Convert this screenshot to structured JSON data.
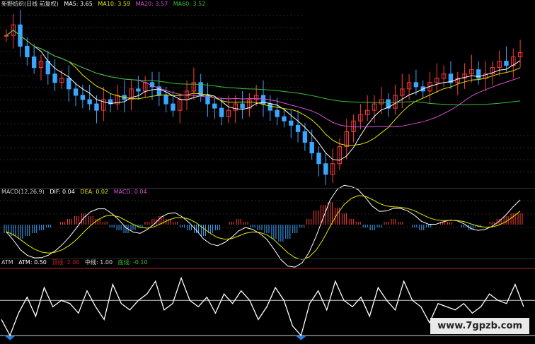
{
  "header_kline": {
    "title": "新野纺织(日线 前复权)",
    "ma5": "MA5: 3.65",
    "ma10": "MA10: 3.59",
    "ma20": "MA20: 3.57",
    "ma60": "MA60: 3.52"
  },
  "header_macd": {
    "title": "MACD(12,26,9)",
    "dif": "DIF: 0.04",
    "dea": "DEA: 0.02",
    "macd": "MACD: 0.04"
  },
  "header_atm": {
    "title": "ATM",
    "atm": "ATM: 0.50",
    "top": "顶线: 2.00",
    "mid": "中线: 1.00",
    "bottom": "底线: -0.10"
  },
  "watermark": "www.7gpzb.com",
  "colors": {
    "up": "#ff3b3b",
    "down": "#3aa6ff",
    "ma5": "#ffffff",
    "ma10": "#e6e600",
    "ma20": "#d94fd9",
    "ma60": "#36c236",
    "atm": "#ffffff",
    "atm_fill": "#2e7bd6",
    "top_line": "#cc2222"
  },
  "chart_data": [
    {
      "type": "candlestick",
      "name": "kline",
      "close": [
        3.7,
        3.75,
        3.65,
        3.6,
        3.55,
        3.58,
        3.52,
        3.48,
        3.5,
        3.45,
        3.42,
        3.4,
        3.38,
        3.35,
        3.4,
        3.38,
        3.42,
        3.4,
        3.45,
        3.44,
        3.48,
        3.46,
        3.42,
        3.38,
        3.35,
        3.4,
        3.44,
        3.48,
        3.42,
        3.38,
        3.36,
        3.32,
        3.35,
        3.38,
        3.36,
        3.4,
        3.42,
        3.38,
        3.35,
        3.32,
        3.3,
        3.28,
        3.25,
        3.2,
        3.15,
        3.1,
        3.05,
        3.1,
        3.18,
        3.25,
        3.3,
        3.33,
        3.35,
        3.38,
        3.4,
        3.36,
        3.42,
        3.45,
        3.48,
        3.46,
        3.44,
        3.48,
        3.5,
        3.52,
        3.48,
        3.5,
        3.52,
        3.54,
        3.5,
        3.52,
        3.55,
        3.58,
        3.56,
        3.6,
        3.62
      ]
    },
    {
      "type": "bar",
      "name": "macd",
      "values": [
        -0.03,
        -0.04,
        -0.05,
        -0.04,
        -0.03,
        -0.02,
        -0.01,
        0.0,
        0.01,
        0.02,
        0.03,
        0.04,
        0.03,
        0.02,
        0.01,
        -0.01,
        -0.02,
        -0.03,
        -0.02,
        -0.01,
        0.01,
        0.02,
        0.03,
        0.02,
        0.01,
        -0.01,
        -0.02,
        -0.03,
        -0.04,
        -0.03,
        -0.02,
        0.0,
        0.01,
        0.02,
        0.01,
        -0.01,
        -0.02,
        -0.03,
        -0.05,
        -0.06,
        -0.05,
        -0.03,
        -0.01,
        0.02,
        0.05,
        0.07,
        0.08,
        0.06,
        0.04,
        0.02,
        0.01,
        -0.01,
        -0.02,
        -0.01,
        0.01,
        0.02,
        0.01,
        0.0,
        -0.01,
        -0.02,
        -0.01,
        0.0,
        0.01,
        0.01,
        0.0,
        -0.01,
        -0.02,
        -0.01,
        0.0,
        0.01,
        0.02,
        0.03,
        0.04,
        0.04
      ]
    },
    {
      "type": "line",
      "name": "atm",
      "values": [
        0.4,
        -0.1,
        0.6,
        1.1,
        0.5,
        1.4,
        0.8,
        1.0,
        0.9,
        0.6,
        1.3,
        0.8,
        0.4,
        1.5,
        0.9,
        0.7,
        1.0,
        1.2,
        1.6,
        0.7,
        0.9,
        1.7,
        1.0,
        0.8,
        1.1,
        0.6,
        1.2,
        0.9,
        1.3,
        1.0,
        0.4,
        0.8,
        1.4,
        1.0,
        0.2,
        -0.1,
        0.9,
        1.3,
        0.7,
        1.6,
        1.0,
        0.8,
        1.1,
        0.5,
        1.4,
        1.0,
        0.7,
        1.6,
        1.0,
        0.8,
        0.3,
        0.9,
        0.8,
        0.7,
        0.9,
        0.6,
        0.8,
        1.2,
        1.0,
        0.9,
        1.5,
        0.8
      ],
      "reference_lines": {
        "top": 2.0,
        "mid": 1.0,
        "bottom": -0.1
      }
    }
  ]
}
